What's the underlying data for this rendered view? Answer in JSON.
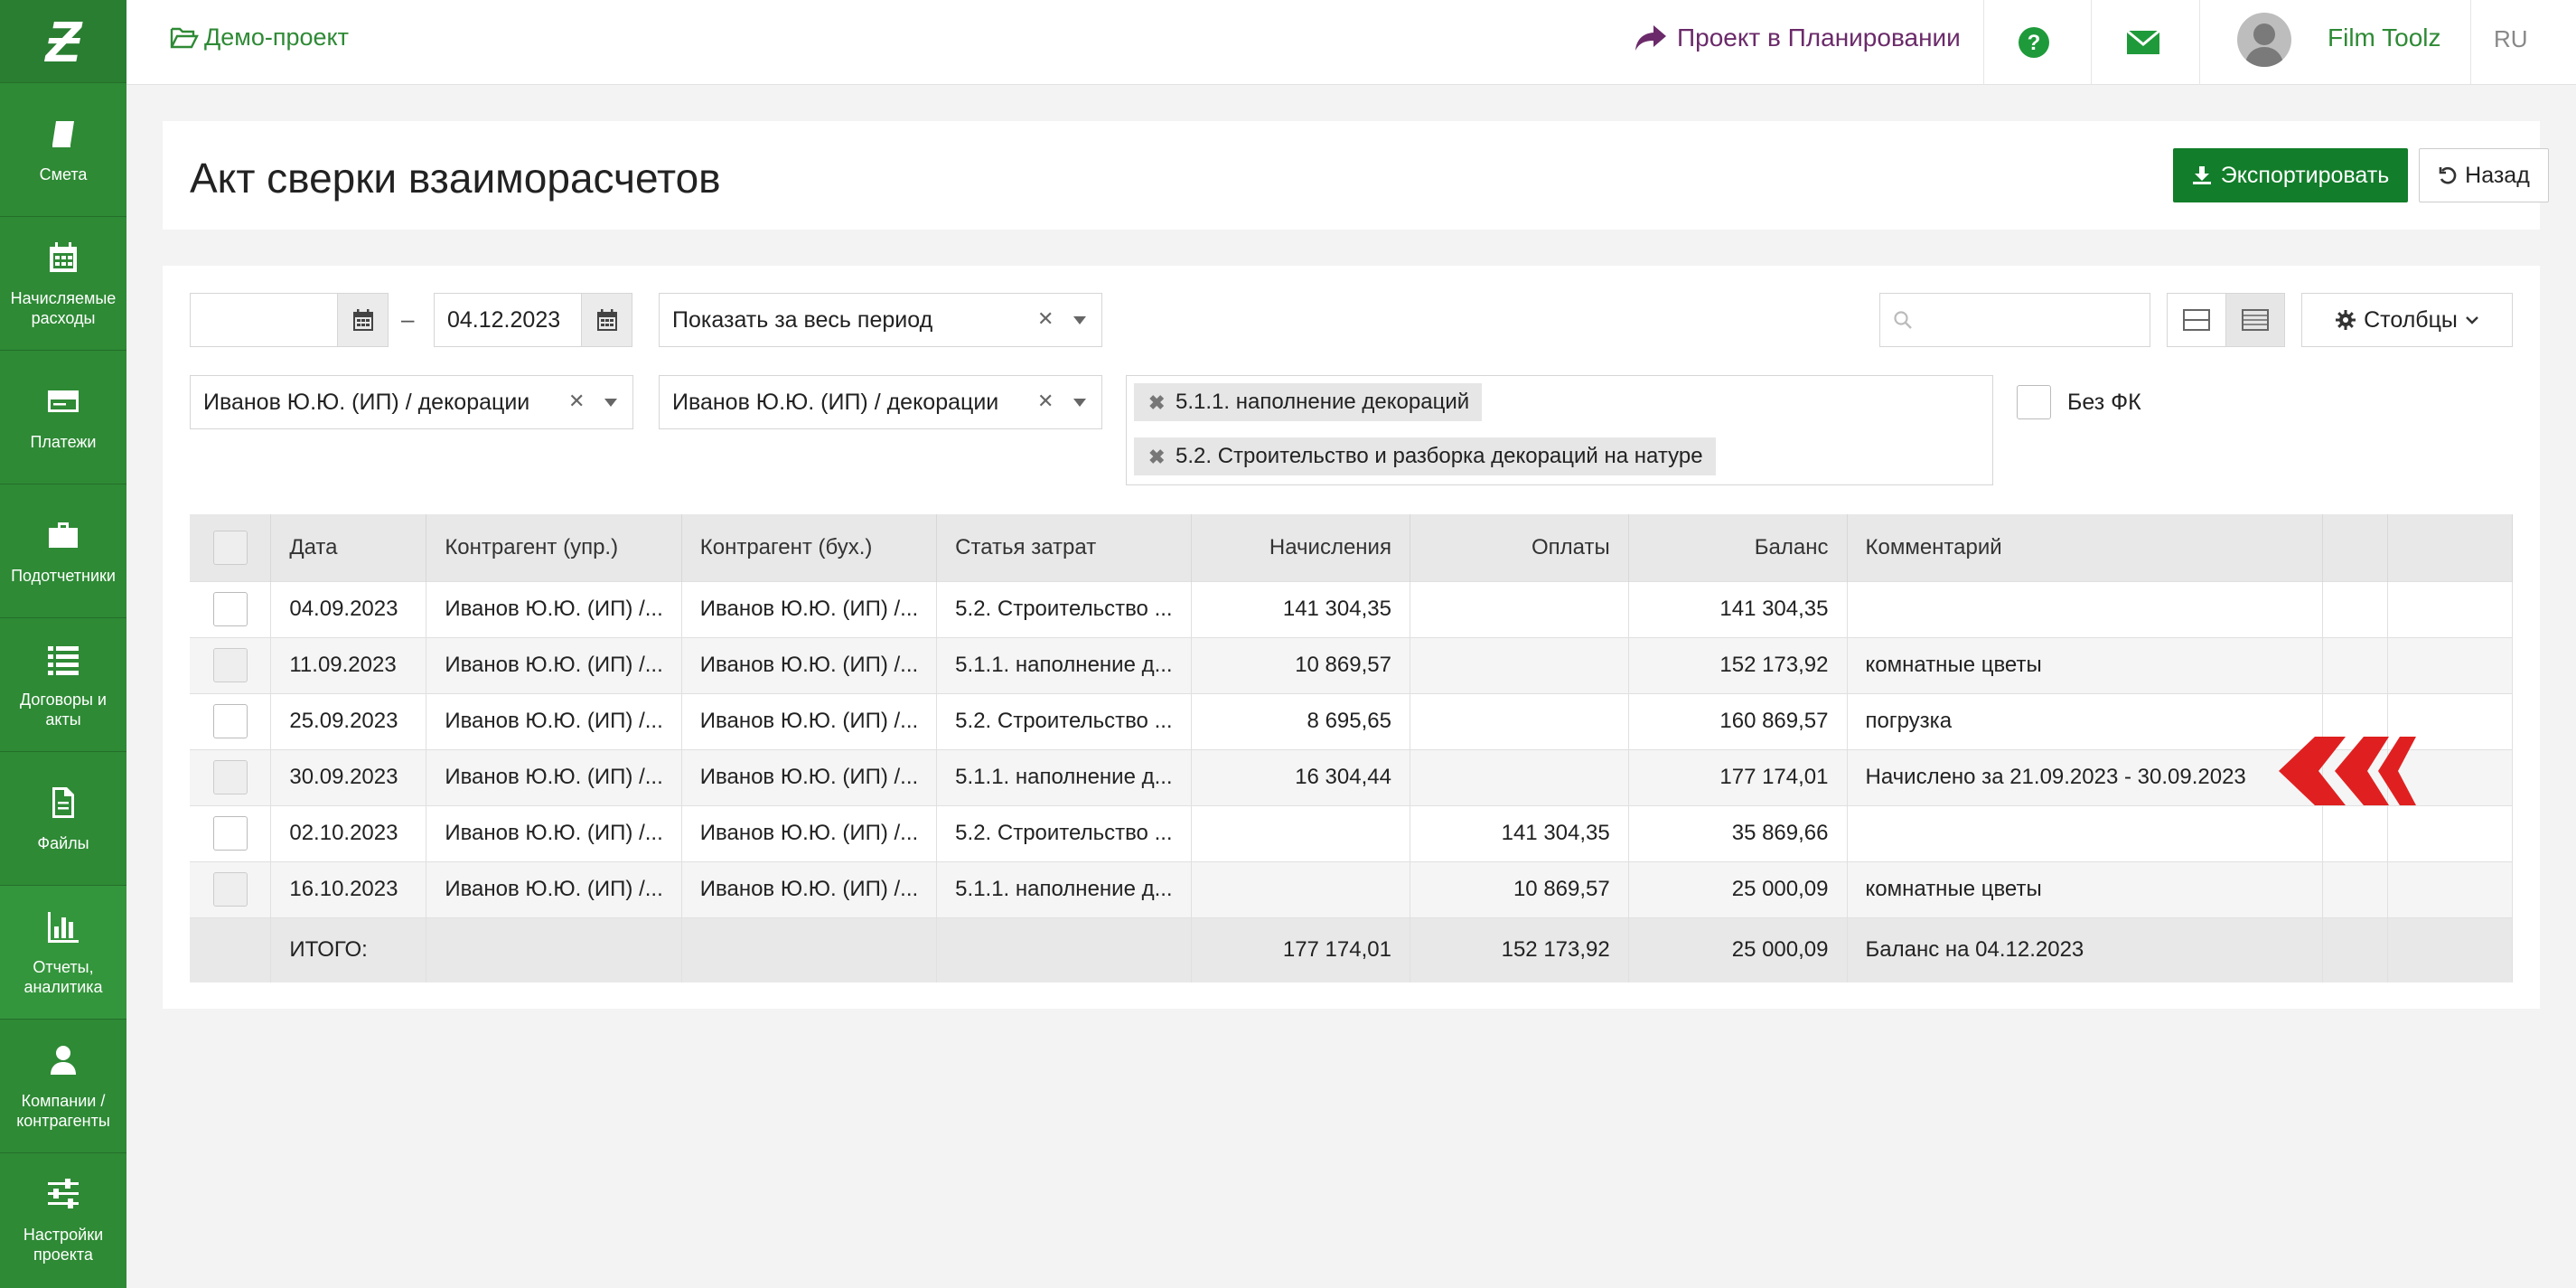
{
  "sidebar": {
    "logo": "Ƶ",
    "items": [
      {
        "label": "Смета",
        "icon": "book-icon"
      },
      {
        "label": "Начисляемые расходы",
        "icon": "calendar-icon"
      },
      {
        "label": "Платежи",
        "icon": "credit-card-icon"
      },
      {
        "label": "Подотчетники",
        "icon": "briefcase-icon"
      },
      {
        "label": "Договоры и акты",
        "icon": "list-icon"
      },
      {
        "label": "Файлы",
        "icon": "file-icon"
      },
      {
        "label": "Отчеты, аналитика",
        "icon": "bar-chart-icon"
      },
      {
        "label": "Компании / контрагенты",
        "icon": "user-icon"
      },
      {
        "label": "Настройки проекта",
        "icon": "sliders-icon"
      }
    ]
  },
  "topbar": {
    "project": "Демо-проект",
    "status": "Проект в Планировании",
    "user": "Film Toolz",
    "lang": "RU"
  },
  "header": {
    "title": "Акт сверки взаиморасчетов",
    "export_label": "Экспортировать",
    "back_label": "Назад"
  },
  "colors": {
    "brand": "#2e8a35",
    "accent": "#127d2a",
    "status": "#6b2a6a",
    "marker": "#e02020"
  },
  "filters": {
    "date_from": "",
    "date_to": "04.12.2023",
    "period": "Показать за весь период",
    "contractor_mgmt": "Иванов Ю.Ю. (ИП) / декорации",
    "contractor_acc": "Иванов Ю.Ю. (ИП) / декорации",
    "tags": [
      "5.1.1. наполнение декораций",
      "5.2. Строительство и разборка декораций на натуре"
    ],
    "no_fk_label": "Без ФК",
    "search_placeholder": "",
    "columns_label": "Столбцы"
  },
  "table": {
    "headers": [
      "Дата",
      "Контрагент (упр.)",
      "Контрагент (бух.)",
      "Статья затрат",
      "Начисления",
      "Оплаты",
      "Баланс",
      "Комментарий"
    ],
    "rows": [
      {
        "date": "04.09.2023",
        "cmgmt": "Иванов Ю.Ю. (ИП) /...",
        "cacc": "Иванов Ю.Ю. (ИП) /...",
        "item": "5.2. Строительство ...",
        "accr": "141 304,35",
        "pay": "",
        "bal": "141 304,35",
        "comment": ""
      },
      {
        "date": "11.09.2023",
        "cmgmt": "Иванов Ю.Ю. (ИП) /...",
        "cacc": "Иванов Ю.Ю. (ИП) /...",
        "item": "5.1.1. наполнение д...",
        "accr": "10 869,57",
        "pay": "",
        "bal": "152 173,92",
        "comment": "комнатные цветы"
      },
      {
        "date": "25.09.2023",
        "cmgmt": "Иванов Ю.Ю. (ИП) /...",
        "cacc": "Иванов Ю.Ю. (ИП) /...",
        "item": "5.2. Строительство ...",
        "accr": "8 695,65",
        "pay": "",
        "bal": "160 869,57",
        "comment": "погрузка"
      },
      {
        "date": "30.09.2023",
        "cmgmt": "Иванов Ю.Ю. (ИП) /...",
        "cacc": "Иванов Ю.Ю. (ИП) /...",
        "item": "5.1.1. наполнение д...",
        "accr": "16 304,44",
        "pay": "",
        "bal": "177 174,01",
        "comment": "Начислено за 21.09.2023 - 30.09.2023"
      },
      {
        "date": "02.10.2023",
        "cmgmt": "Иванов Ю.Ю. (ИП) /...",
        "cacc": "Иванов Ю.Ю. (ИП) /...",
        "item": "5.2. Строительство ...",
        "accr": "",
        "pay": "141 304,35",
        "bal": "35 869,66",
        "comment": ""
      },
      {
        "date": "16.10.2023",
        "cmgmt": "Иванов Ю.Ю. (ИП) /...",
        "cacc": "Иванов Ю.Ю. (ИП) /...",
        "item": "5.1.1. наполнение д...",
        "accr": "",
        "pay": "10 869,57",
        "bal": "25 000,09",
        "comment": "комнатные цветы"
      }
    ],
    "total": {
      "label": "ИТОГО:",
      "accr": "177 174,01",
      "pay": "152 173,92",
      "bal": "25 000,09",
      "comment": "Баланс на 04.12.2023"
    }
  }
}
